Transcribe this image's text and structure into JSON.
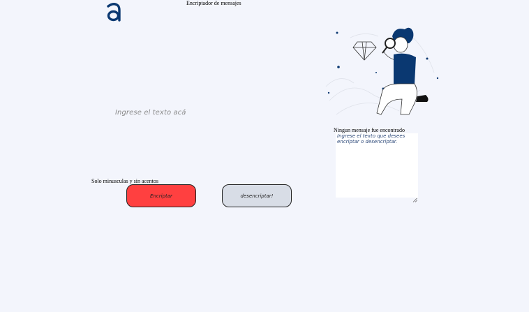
{
  "header": {
    "logo_icon": "alura-a-logo-icon",
    "title": "Encriptador de mensajes"
  },
  "input": {
    "placeholder": "Ingrese el texto acá"
  },
  "hint": "Solo minusculas y sin acentos",
  "buttons": {
    "encrypt_label": "Encriptar",
    "decrypt_label": "desencriptar!"
  },
  "result": {
    "illustration_icon": "person-with-magnifier-illustration",
    "title": "Ningun mensaje fue encontrado",
    "placeholder": "Ingrese el texto que desees encriptar o desencriptar."
  },
  "colors": {
    "background": "#f3f5fc",
    "brand": "#0a3871",
    "encrypt_button": "#ff4040",
    "decrypt_button": "#d8dde6"
  }
}
